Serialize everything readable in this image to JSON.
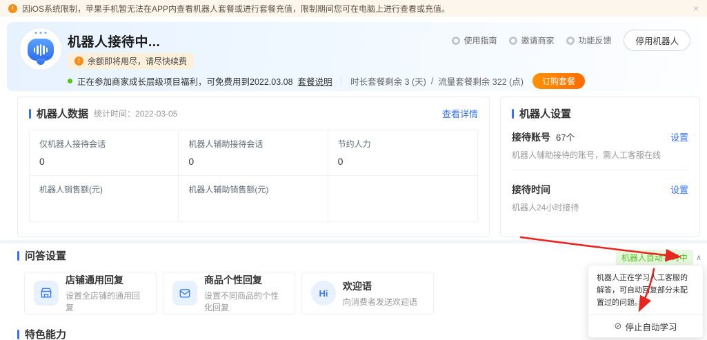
{
  "banner": {
    "icon": "!",
    "text": "因iOS系统限制，苹果手机暂无法在APP内查看机器人套餐或进行套餐充值，限制期间您可在电脑上进行查看或充值。",
    "close": "×"
  },
  "header": {
    "title": "机器人接待中...",
    "links": [
      {
        "label": "使用指南"
      },
      {
        "label": "邀请商家"
      },
      {
        "label": "功能反馈"
      }
    ],
    "stop_button": "停用机器人",
    "alert": {
      "icon": "!",
      "text": "余额即将用尽，请尽快续费"
    },
    "promo": {
      "status": "正在参加商家成长层级项目福利，可免费用到2022.03.08",
      "plan_link": "套餐说明",
      "separator": "｜",
      "duration": "时长套餐剩余 3 (天)",
      "slash": "/",
      "flow": "流量套餐剩余 322 (点)",
      "order_button": "订购套餐"
    }
  },
  "data_panel": {
    "title": "机器人数据",
    "subtitle": "统计时间：2022-03-05",
    "detail_link": "查看详情",
    "stats": [
      {
        "label": "仅机器人接待会话",
        "value": "0"
      },
      {
        "label": "机器人辅助接待会话",
        "value": "0"
      },
      {
        "label": "节约人力",
        "value": "0"
      },
      {
        "label": "机器人销售额(元)",
        "value": ""
      },
      {
        "label": "机器人辅助销售额(元)",
        "value": ""
      }
    ]
  },
  "settings_panel": {
    "title": "机器人设置",
    "items": [
      {
        "label": "接待账号",
        "count": "67个",
        "action": "设置",
        "desc": "机器人辅助接待的账号，需人工客服在线"
      },
      {
        "label": "接待时间",
        "count": "",
        "action": "设置",
        "desc": "机器人24小时接待"
      }
    ]
  },
  "qa_section": {
    "title": "问答设置",
    "badge": "机器人自动学习中",
    "caret": "∧",
    "cards": [
      {
        "title": "店铺通用回复",
        "desc": "设置全店铺的通用回复"
      },
      {
        "title": "商品个性回复",
        "desc": "设置不同商品的个性化回复"
      },
      {
        "title": "欢迎语",
        "desc": "向消费者发送欢迎语",
        "icon_text": "Hi"
      }
    ],
    "popup": {
      "text": "机器人正在学习人工客服的解答，可自动回复部分未配置过的问题。",
      "stop_icon": "⊘",
      "stop_label": "停止自动学习"
    }
  },
  "feature_section": {
    "title": "特色能力"
  },
  "colors": {
    "accent_blue": "#3370ff",
    "accent_orange": "#ff7a00",
    "accent_green": "#52c41a",
    "banner_bg": "#fdf6ec",
    "annotation_red": "#e8261f"
  }
}
